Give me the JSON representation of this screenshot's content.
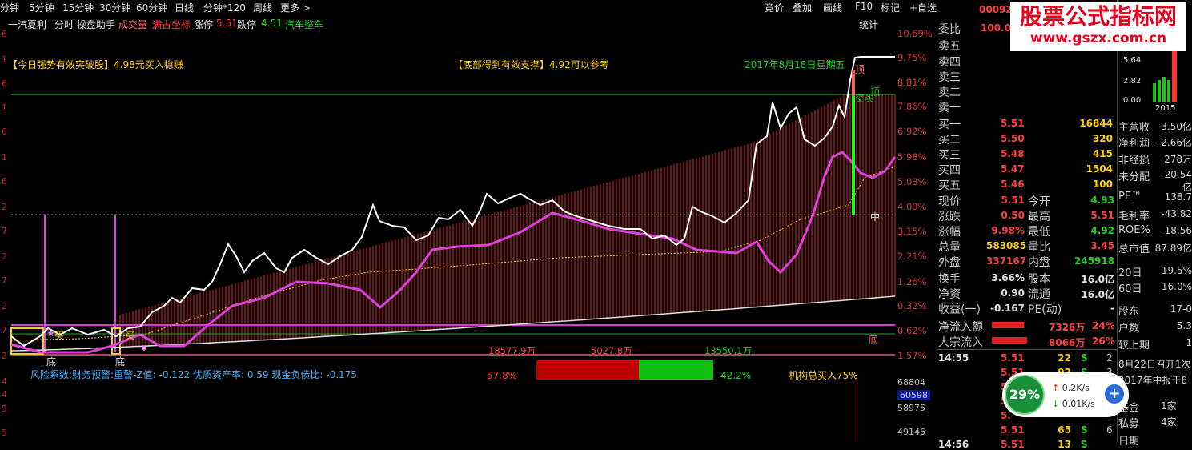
{
  "top_menu": [
    "分钟",
    "5分钟",
    "15分钟",
    "30分钟",
    "60分钟",
    "日线",
    "分钟*120",
    "周线",
    "更多 >"
  ],
  "top_tools": [
    "竞价",
    "叠加",
    "画线",
    "F10",
    "标记",
    "+自选"
  ],
  "info_bar": {
    "stock_name": "一汽夏利",
    "mode": "分时",
    "helper": "操盘助手",
    "deal": "成交量",
    "full_coord": "满占坐标",
    "limit_up_label": "涨停",
    "limit_up_value": "5.51",
    "limit_down_label": "跌停",
    "limit_down_value": "4.51",
    "sector": "汽车整车",
    "stats": "统计"
  },
  "annotations": {
    "breakout": "【今日强势有效突破股】4.98元买入稳赚",
    "support": "【底部得到有效支撑】4.92可以参考",
    "date": "2017年8月18日星期五",
    "ding": "顶",
    "ding2": "顶",
    "buy_label": "买",
    "buy_label2": "买",
    "cross_label": "交买",
    "di1": "底",
    "di2": "底",
    "di3": "底",
    "zhong": "中"
  },
  "left_axis": [
    "6",
    "1",
    "6",
    "1",
    "6",
    "1",
    "6",
    "2",
    "7",
    "2",
    "7",
    "2",
    "7",
    "2",
    "4",
    "4",
    "5",
    "5"
  ],
  "pct_axis": [
    "10.69%",
    "9.75%",
    "8.81%",
    "7.86%",
    "6.92%",
    "5.98%",
    "5.03%",
    "4.09%",
    "3.15%",
    "2.21%",
    "1.26%",
    "0.32%",
    "0.62%",
    "1.57%"
  ],
  "flows": {
    "left": "18577.9万",
    "mid": "5027.8万",
    "right": "13550.1万"
  },
  "risk_text": "风险系数:财务预警:重警-Z值: -0.122 优质资产率: 0.59 现金负债比: -0.175",
  "ratio": {
    "red_pct": "57.8%",
    "green_pct": "42.2%",
    "red_fraction": 0.578
  },
  "inst_buy": "机构总买入75%",
  "vol_ticks": [
    "68804",
    "60598",
    "58975",
    "49146"
  ],
  "order_book": {
    "weibi": "委比",
    "weibi_val": "100.0",
    "code_partial": "00092",
    "sells": [
      {
        "label": "卖五"
      },
      {
        "label": "卖四"
      },
      {
        "label": "卖三"
      },
      {
        "label": "卖二"
      },
      {
        "label": "卖一"
      }
    ],
    "buys": [
      {
        "label": "买一",
        "price": "5.51",
        "vol": "16844"
      },
      {
        "label": "买二",
        "price": "5.50",
        "vol": "320"
      },
      {
        "label": "买三",
        "price": "5.48",
        "vol": "415"
      },
      {
        "label": "买四",
        "price": "5.47",
        "vol": "1504"
      },
      {
        "label": "买五",
        "price": "5.46",
        "vol": "100"
      }
    ]
  },
  "quote": [
    {
      "l1": "现价",
      "v1": "5.51",
      "c1": "#ff4040",
      "l2": "今开",
      "v2": "4.93",
      "c2": "#20d020"
    },
    {
      "l1": "涨跌",
      "v1": "0.50",
      "c1": "#ff4040",
      "l2": "最高",
      "v2": "5.51",
      "c2": "#ff4040"
    },
    {
      "l1": "涨幅",
      "v1": "9.98%",
      "c1": "#ff4040",
      "l2": "最低",
      "v2": "4.92",
      "c2": "#20d020"
    },
    {
      "l1": "总量",
      "v1": "583085",
      "c1": "#ffd000",
      "l2": "量比",
      "v2": "3.45",
      "c2": "#ff4040"
    },
    {
      "l1": "外盘",
      "v1": "337167",
      "c1": "#ff4040",
      "l2": "内盘",
      "v2": "245918",
      "c2": "#20d020"
    },
    {
      "l1": "换手",
      "v1": "3.66%",
      "c1": "#e0e0e0",
      "l2": "股本",
      "v2": "16.0亿",
      "c2": "#e0e0e0"
    },
    {
      "l1": "净资",
      "v1": "0.90",
      "c1": "#e0e0e0",
      "l2": "流通",
      "v2": "16.0亿",
      "c2": "#e0e0e0"
    },
    {
      "l1": "收益(一)",
      "v1": "-0.167",
      "c1": "#e0e0e0",
      "l2": "PE(动)",
      "v2": "-",
      "c2": "#e0e0e0"
    }
  ],
  "net_inflow": {
    "label": "净流入额",
    "value": "7326万",
    "pct": "24%"
  },
  "block_inflow": {
    "label": "大宗流入",
    "value": "8066万",
    "pct": "26%"
  },
  "ticks": [
    {
      "time": "14:55",
      "price": "5.51",
      "vol": "22",
      "side": "S",
      "n": "2"
    },
    {
      "time": "",
      "price": "5.51",
      "vol": "92",
      "side": "S",
      "n": "3"
    },
    {
      "time": "",
      "price": "5.",
      "vol": "",
      "side": "",
      "n": ""
    },
    {
      "time": "",
      "price": "5.",
      "vol": "",
      "side": "",
      "n": ""
    },
    {
      "time": "",
      "price": "5.",
      "vol": "",
      "side": "",
      "n": ""
    },
    {
      "time": "",
      "price": "5.51",
      "vol": "65",
      "side": "S",
      "n": "6"
    },
    {
      "time": "14:56",
      "price": "5.51",
      "vol": "13",
      "side": "S",
      "n": ""
    }
  ],
  "right_panel": {
    "mini_chart": {
      "ticks": [
        "5.64",
        "2.82",
        "0.00"
      ],
      "year": "2015"
    },
    "fin": [
      {
        "label": "主营收",
        "value": "3.50亿"
      },
      {
        "label": "净利润",
        "value": "-2.66亿"
      },
      {
        "label": "非经损",
        "value": "278万"
      },
      {
        "label": "未分配",
        "value": "-20.54亿"
      },
      {
        "label": "",
        "value": ""
      },
      {
        "label": "PE™",
        "value": "138.7"
      },
      {
        "label": "毛利率",
        "value": "-43.82"
      },
      {
        "label": "ROE%",
        "value": "-18.56"
      },
      {
        "label": "总市值",
        "value": "87.89亿"
      },
      {
        "label": "20日",
        "value": "19.5%"
      },
      {
        "label": "60日",
        "value": "16.0%"
      },
      {
        "label": "",
        "value": ""
      },
      {
        "label": "股东",
        "value": "17-0"
      },
      {
        "label": "户数",
        "value": "5.3"
      },
      {
        "label": "较上期",
        "value": "1"
      }
    ],
    "events": [
      "8月22日召开1次",
      "2017年中报于8"
    ],
    "holders": [
      {
        "label": "基金",
        "value": "1家"
      },
      {
        "label": "私募",
        "value": "4家"
      },
      {
        "label": "日期",
        "value": ""
      }
    ]
  },
  "watermark": {
    "title": "股票公式指标网",
    "url": "www.gszx.com.cn"
  },
  "net_widget": {
    "pct": "29%",
    "up": "0.2K/s",
    "down": "0.01K/s",
    "plus": "+"
  }
}
